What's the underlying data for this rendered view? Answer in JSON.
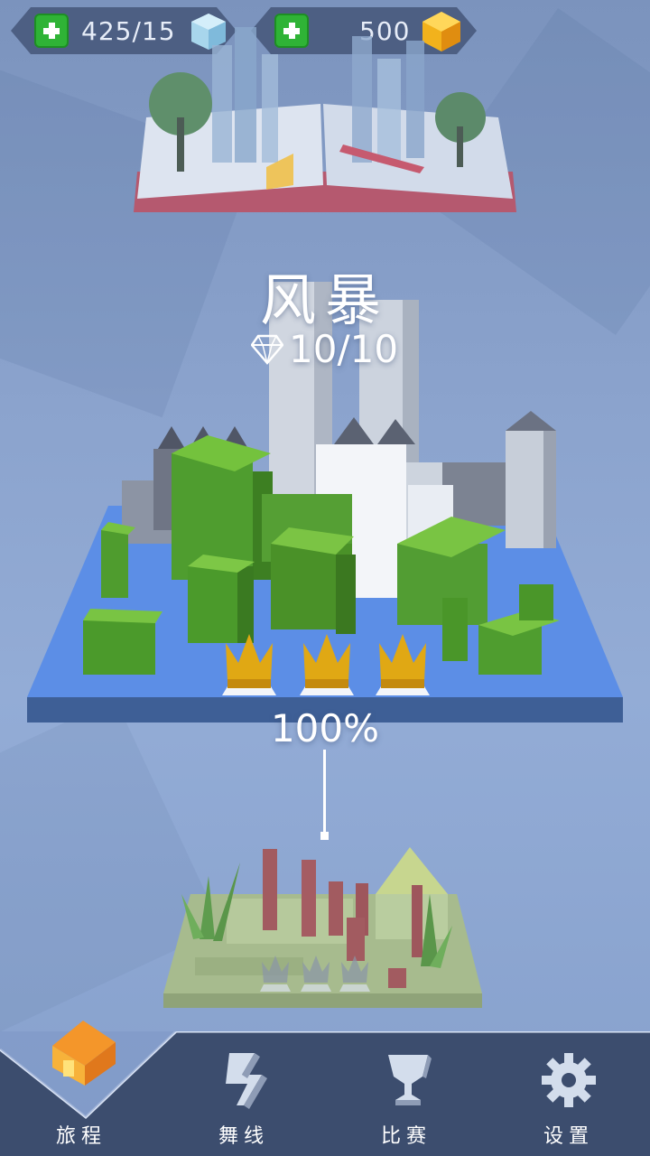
{
  "top_bar": {
    "energy": {
      "value": "425/15",
      "icon": "ice-cube-icon"
    },
    "coins": {
      "value": "500",
      "icon": "gold-cube-icon"
    }
  },
  "current_level": {
    "title": "风暴",
    "gems": "10/10",
    "progress": "100%",
    "crowns": 3
  },
  "next_level": {
    "crowns": 3
  },
  "nav": {
    "items": [
      {
        "label": "旅程",
        "icon": "house-icon",
        "active": true
      },
      {
        "label": "舞线",
        "icon": "dancing-line-icon",
        "active": false
      },
      {
        "label": "比赛",
        "icon": "trophy-icon",
        "active": false
      },
      {
        "label": "设置",
        "icon": "gear-icon",
        "active": false
      }
    ]
  },
  "colors": {
    "accent_green": "#2fb336",
    "gold": "#f2b21c",
    "nav_bg": "#3c4d6e",
    "home_orange": "#f4962a"
  }
}
